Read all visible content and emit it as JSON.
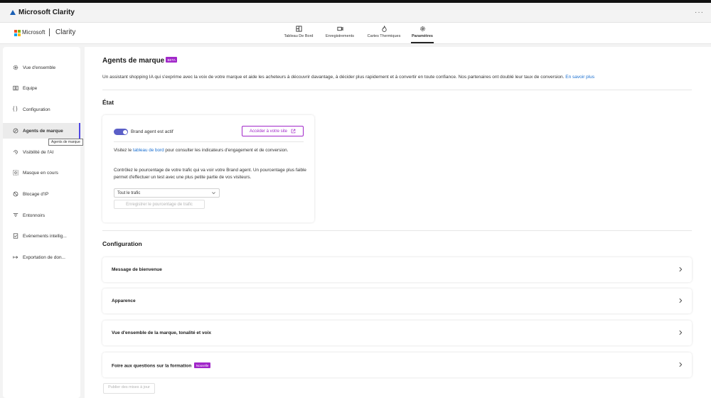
{
  "window": {
    "title": "Microsoft Clarity",
    "menu_icon": "more-dots-icon"
  },
  "header": {
    "brand": "Microsoft",
    "product": "Clarity",
    "tabs": [
      {
        "label": "Tableau De Bord",
        "icon": "dashboard-icon"
      },
      {
        "label": "Enregistrements",
        "icon": "video-icon"
      },
      {
        "label": "Cartes Thermiques",
        "icon": "flame-icon"
      },
      {
        "label": "Paramètres",
        "icon": "gear-icon",
        "active": true
      }
    ]
  },
  "sidebar": {
    "items": [
      {
        "label": "Vue d'ensemble",
        "icon": "settings-icon"
      },
      {
        "label": "Équipe",
        "icon": "team-icon"
      },
      {
        "label": "Configuration",
        "icon": "braces-icon"
      },
      {
        "label": "Agents de marque",
        "icon": "brand-agent-icon",
        "active": true
      },
      {
        "label": "Visibilité de l'AI",
        "icon": "ai-visibility-icon"
      },
      {
        "label": "Masque en cours",
        "icon": "mask-icon"
      },
      {
        "label": "Blocage d'IP",
        "icon": "ip-block-icon"
      },
      {
        "label": "Entonnoirs",
        "icon": "funnel-icon"
      },
      {
        "label": "Événements intellig...",
        "icon": "smart-events-icon"
      },
      {
        "label": "Exportation de don...",
        "icon": "export-icon"
      }
    ],
    "tooltip": "Agents de marque"
  },
  "main": {
    "title": "Agents de marque",
    "badge": "BETA",
    "description": "Un assistant shopping IA qui s'exprime avec la voix de votre marque et aide les acheteurs à découvrir davantage, à décider plus rapidement et à convertir en toute confiance. Nos partenaires ont doublé leur taux de conversion.",
    "learn_more": "En savoir plus",
    "state": {
      "heading": "État",
      "toggle_label": "Brand agent est actif",
      "toggle_on": true,
      "visit_button": "Accéder à votre site",
      "visit_pre": "Visitez le",
      "visit_link": "tableau de bord",
      "visit_post": "pour consulter les indicateurs d'engagement et de conversion.",
      "traffic_text": "Contrôlez le pourcentage de votre trafic qui va voir votre Brand agent. Un pourcentage plus faible permet d'effectuer un test avec une plus petite partie de vos visiteurs.",
      "traffic_select": "Tout le trafic",
      "save_button": "Enregistrer le pourcentage de trafic"
    },
    "config": {
      "heading": "Configuration",
      "rows": [
        {
          "label": "Message de bienvenue"
        },
        {
          "label": "Apparence"
        },
        {
          "label": "Vue d'ensemble de la marque, tonalité et voix"
        },
        {
          "label": "Foire aux questions sur la formation",
          "badge": "Nouvelle"
        }
      ],
      "publish_button": "Publier des mises à jour"
    }
  },
  "colors": {
    "accent": "#a127c9",
    "toggle": "#5b5fc7",
    "link": "#1a6fd0"
  }
}
